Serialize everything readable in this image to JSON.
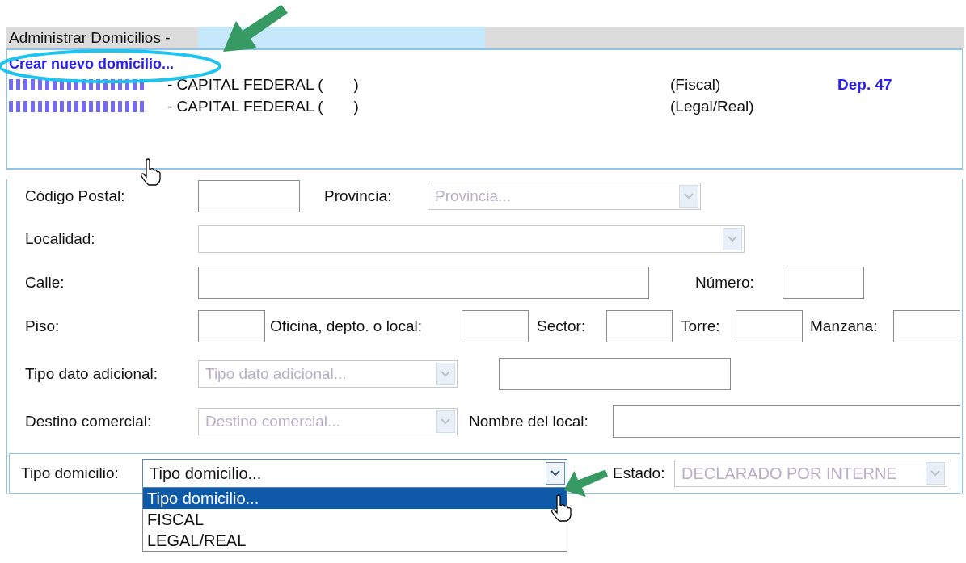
{
  "title": "Administrar Domicilios -",
  "create_link": "Crear nuevo domicilio...",
  "addresses": [
    {
      "redacted": true,
      "city": "- CAPITAL FEDERAL (",
      "suffix": ")",
      "type": "(Fiscal)",
      "dep": "Dep. 47"
    },
    {
      "redacted": true,
      "city": "- CAPITAL FEDERAL (",
      "suffix": ")",
      "type": "(Legal/Real)"
    }
  ],
  "form_rows": [
    [
      {
        "kind": "label",
        "text": "Código Postal:"
      },
      {
        "kind": "input"
      },
      {
        "kind": "label",
        "text": "Provincia:"
      },
      {
        "kind": "select",
        "value": "Provincia...",
        "disabled": true
      }
    ],
    [
      {
        "kind": "label",
        "text": "Localidad:"
      },
      {
        "kind": "select",
        "disabled": true
      }
    ],
    [
      {
        "kind": "label",
        "text": "Calle:"
      },
      {
        "kind": "input"
      },
      {
        "kind": "label",
        "text": "Número:"
      },
      {
        "kind": "input"
      }
    ],
    [
      {
        "kind": "label",
        "text": "Piso:"
      },
      {
        "kind": "input"
      },
      {
        "kind": "label",
        "text": "Oficina, depto. o local:"
      },
      {
        "kind": "input"
      },
      {
        "kind": "label",
        "text": "Sector:"
      },
      {
        "kind": "input"
      },
      {
        "kind": "label",
        "text": "Torre:"
      },
      {
        "kind": "input"
      },
      {
        "kind": "label",
        "text": "Manzana:"
      },
      {
        "kind": "input"
      }
    ],
    [
      {
        "kind": "label",
        "text": "Tipo dato adicional:"
      },
      {
        "kind": "select",
        "value": "Tipo dato adicional...",
        "disabled": true
      },
      {
        "kind": "input"
      }
    ],
    [
      {
        "kind": "label",
        "text": "Destino comercial:"
      },
      {
        "kind": "select",
        "value": "Destino comercial...",
        "disabled": true
      },
      {
        "kind": "label",
        "text": "Nombre del local:"
      },
      {
        "kind": "input"
      }
    ]
  ],
  "bottom_row": [
    {
      "kind": "label",
      "text": "Tipo domicilio:"
    },
    {
      "kind": "select",
      "value": "Tipo domicilio...",
      "disabled": false,
      "expanded": true,
      "options": [
        {
          "label": "Tipo domicilio...",
          "selected": true
        },
        {
          "label": "FISCAL",
          "selected": false
        },
        {
          "label": "LEGAL/REAL",
          "selected": false
        }
      ]
    },
    {
      "kind": "label",
      "text": "Estado:"
    },
    {
      "kind": "select",
      "value": "DECLARADO POR INTERNE",
      "disabled": true
    }
  ]
}
